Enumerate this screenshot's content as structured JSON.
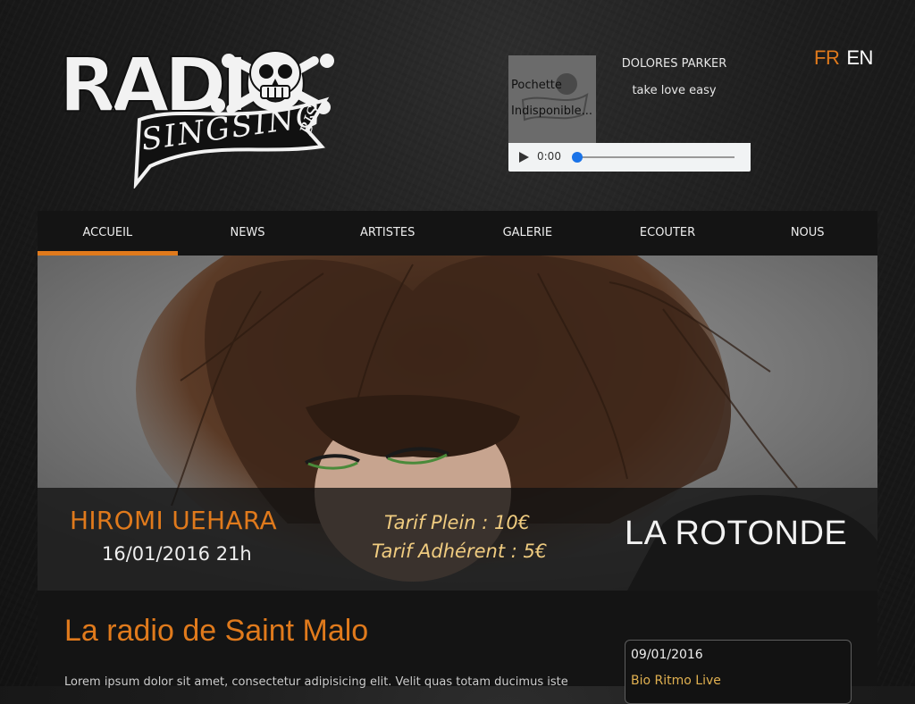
{
  "header": {
    "logo": {
      "word_top": "RADIO",
      "word_bottom": "SINGSING",
      "word_suffix": "BIS",
      "icon": "skull-crossbones-icon"
    },
    "player": {
      "cover_line1": "Pochette",
      "cover_line2": "Indisponible...",
      "artist": "DOLORES PARKER",
      "title": "take love easy",
      "time": "0:00",
      "progress": 0
    },
    "lang": {
      "fr": "FR",
      "en": "EN",
      "active": "FR"
    }
  },
  "nav": {
    "items": [
      {
        "label": "ACCUEIL",
        "active": true
      },
      {
        "label": "NEWS"
      },
      {
        "label": "ARTISTES"
      },
      {
        "label": "GALERIE"
      },
      {
        "label": "ECOUTER"
      },
      {
        "label": "NOUS"
      }
    ]
  },
  "hero": {
    "artist": "HIROMI UEHARA",
    "date": "16/01/2016 21h",
    "price_full": "Tarif Plein : 10€",
    "price_member": "Tarif Adhérent : 5€",
    "venue": "LA ROTONDE"
  },
  "main": {
    "heading": "La radio de Saint Malo",
    "intro": "Lorem ipsum dolor sit amet, consectetur adipisicing elit. Velit quas totam ducimus iste",
    "news": {
      "date": "09/01/2016",
      "title": "Bio Ritmo Live"
    }
  },
  "colors": {
    "accent": "#e07a1c",
    "price": "#f0cc80",
    "news_link": "#e0b050"
  }
}
